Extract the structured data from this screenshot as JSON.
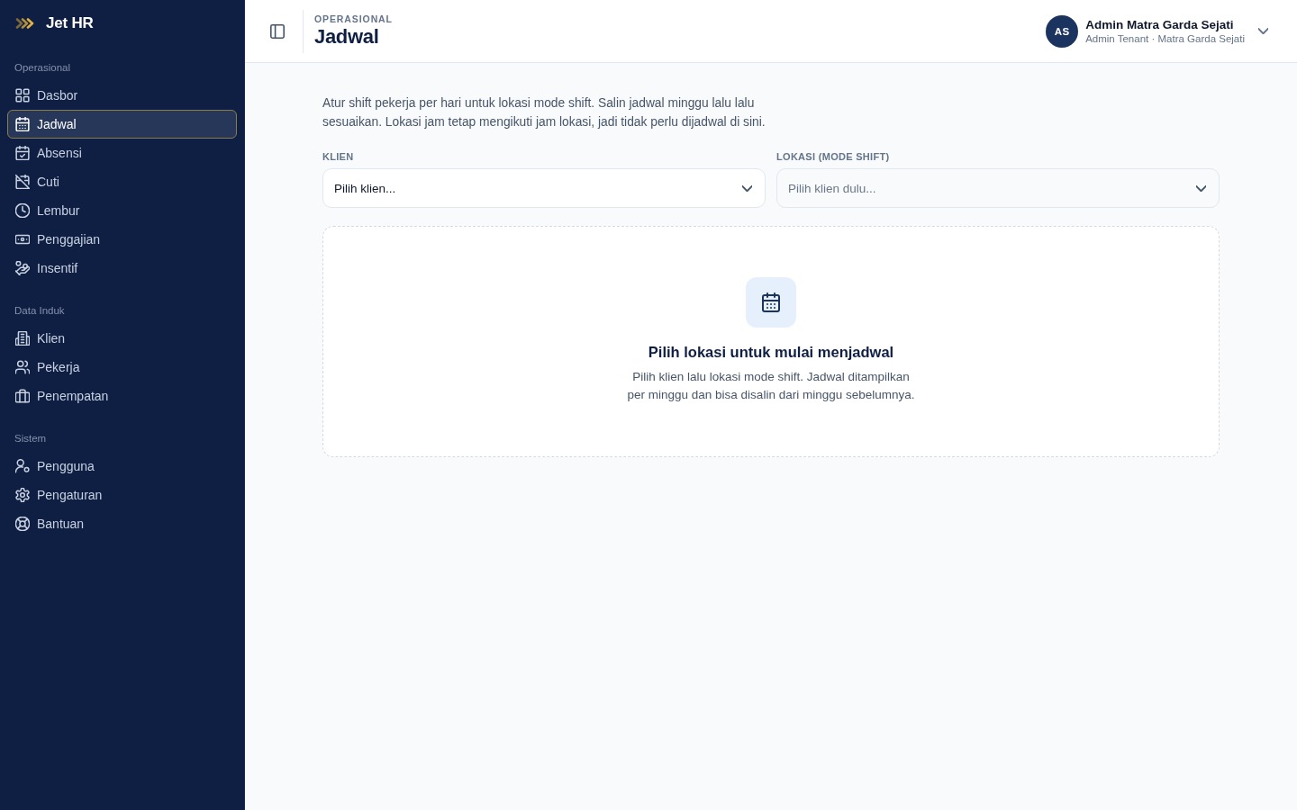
{
  "sidebar": {
    "brand": "Jet HR",
    "sections": [
      {
        "title": "Operasional",
        "items": [
          {
            "label": "Dasbor",
            "selected": false
          },
          {
            "label": "Jadwal",
            "selected": true
          },
          {
            "label": "Absensi",
            "selected": false
          },
          {
            "label": "Cuti",
            "selected": false
          },
          {
            "label": "Lembur",
            "selected": false
          },
          {
            "label": "Penggajian",
            "selected": false
          },
          {
            "label": "Insentif",
            "selected": false
          }
        ]
      },
      {
        "title": "Data Induk",
        "items": [
          {
            "label": "Klien",
            "selected": false
          },
          {
            "label": "Pekerja",
            "selected": false
          },
          {
            "label": "Penempatan",
            "selected": false
          }
        ]
      },
      {
        "title": "Sistem",
        "items": [
          {
            "label": "Pengguna",
            "selected": false
          },
          {
            "label": "Pengaturan",
            "selected": false
          },
          {
            "label": "Bantuan",
            "selected": false
          }
        ]
      }
    ]
  },
  "header": {
    "eyebrow": "OPERASIONAL",
    "title": "Jadwal",
    "user": {
      "initials": "AS",
      "name": "Admin Matra Garda Sejati",
      "role": "Admin Tenant · Matra Garda Sejati"
    }
  },
  "content": {
    "description": "Atur shift pekerja per hari untuk lokasi mode shift. Salin jadwal minggu lalu lalu sesuaikan. Lokasi jam tetap mengikuti jam lokasi, jadi tidak perlu dijadwal di sini.",
    "fields": [
      {
        "label": "KLIEN",
        "placeholder": "Pilih klien...",
        "disabled": false
      },
      {
        "label": "LOKASI (MODE SHIFT)",
        "placeholder": "Pilih klien dulu...",
        "disabled": true
      }
    ],
    "empty_state": {
      "title": "Pilih lokasi untuk mulai menjadwal",
      "message": "Pilih klien lalu lokasi mode shift. Jadwal ditampilkan per minggu dan bisa disalin dari minggu sebelumnya."
    }
  }
}
